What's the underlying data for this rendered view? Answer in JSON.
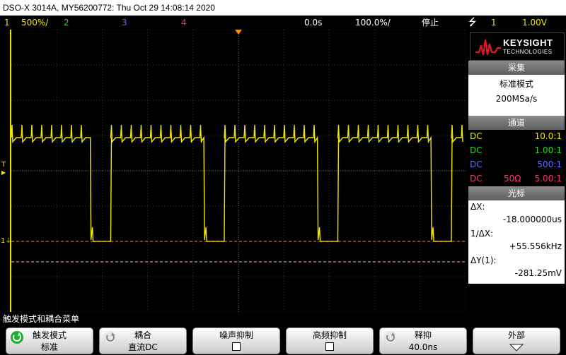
{
  "title": "DSO-X 3014A, MY56200772: Thu Oct 29 14:08:14 2020",
  "status": {
    "ch1_num": "1",
    "ch1_scale": "500%/",
    "ch2_num": "2",
    "ch3_num": "3",
    "ch4_num": "4",
    "time_delay": "0.0s",
    "time_scale": "100.0%/",
    "run_state": "停止",
    "trigger_icon": "trigger-edge-icon",
    "trigger_src": "1",
    "trigger_level": "1.00V"
  },
  "logo": {
    "name": "KEYSIGHT",
    "sub": "TECHNOLOGIES"
  },
  "acquire": {
    "header": "采集",
    "mode": "标准模式",
    "rate": "200MSa/s"
  },
  "channels": {
    "header": "通道",
    "rows": [
      {
        "coupling": "DC",
        "imp": "",
        "probe": "10.0:1",
        "color": "#f2e600"
      },
      {
        "coupling": "DC",
        "imp": "",
        "probe": "1.00:1",
        "color": "#22dd22"
      },
      {
        "coupling": "DC",
        "imp": "",
        "probe": "500:1",
        "color": "#5a6cff"
      },
      {
        "coupling": "DC",
        "imp": "50Ω",
        "probe": "5.00:1",
        "color": "#ff2d80"
      }
    ]
  },
  "cursors": {
    "header": "光标",
    "dx_label": "ΔX:",
    "dx_value": "-18.000000us",
    "inv_label": "1/ΔX:",
    "inv_value": "+55.556kHz",
    "dy_label": "ΔY(1):",
    "dy_value": "-281.25mV"
  },
  "markers": {
    "trigger_t": "T",
    "ground_1": "1"
  },
  "menu": {
    "title": "触发模式和耦合菜单",
    "keys": [
      {
        "l1": "触发模式",
        "l2": "标准",
        "icon": "rotate-knob-icon"
      },
      {
        "l1": "耦合",
        "l2": "直流DC",
        "icon": "rotate-knob-icon"
      },
      {
        "l1": "噪声抑制",
        "l2": "",
        "icon": "checkbox-icon"
      },
      {
        "l1": "高频抑制",
        "l2": "",
        "icon": "checkbox-icon"
      },
      {
        "l1": "释抑",
        "l2": "40.0ns",
        "icon": "rotate-knob-icon"
      },
      {
        "l1": "外部",
        "l2": "",
        "icon": "down-arrow-icon"
      }
    ]
  },
  "colors": {
    "ch1": "#f2e600",
    "ch2": "#22dd22",
    "ch3": "#5a6cff",
    "ch4": "#ff2d80",
    "trigger_marker": "#ff8c00",
    "cursor_line": "#ffb4c8"
  },
  "waveform": {
    "high_level": 1.0,
    "low_level": 0.0,
    "period_divs": 2.5,
    "duty": 0.82
  }
}
